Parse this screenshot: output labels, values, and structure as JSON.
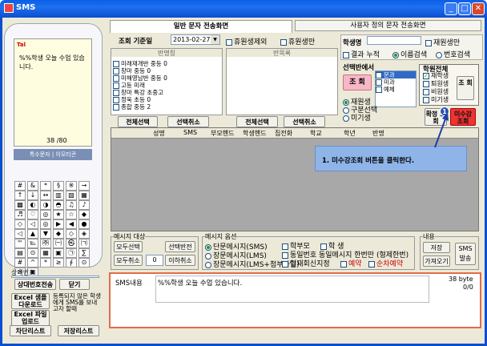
{
  "window": {
    "title": "SMS"
  },
  "phone": {
    "signal_label": "Tal",
    "message": "%%학생 오늘 수업 있습니다.",
    "byte_count": "38 /80",
    "special_chars_button": "특수문자 | 이모티콘",
    "symbols": [
      "#",
      "&",
      "*",
      "§",
      "※",
      "→",
      "↑",
      "↓",
      "↔",
      "▥",
      "▧",
      "▦",
      "▩",
      "◐",
      "◑",
      "◓",
      "♫",
      "♪",
      "♬",
      "♡",
      "◎",
      "★",
      "☆",
      "◆",
      "◇",
      "◁",
      "◎",
      "▶",
      "◀",
      "●",
      "◁",
      "▲",
      "▼",
      "◆",
      "◇",
      "◈",
      "™",
      "℡",
      "㈜",
      "㈠",
      "㉿",
      "㈀",
      "▤",
      "⊙",
      "▦",
      "▣",
      "㉠",
      "∑",
      "#",
      "^",
      "*",
      "≥",
      "∮",
      "⊙",
      "※",
      "▣"
    ],
    "recipient_label": "상대번호",
    "recipient_number": "",
    "name_number_transfer_button": "상대번호전송",
    "close_button": "닫기",
    "excel_sample_button": "Excel 샘플 다운로드",
    "excel_upload_button": "Excel 파일 업로드",
    "unregistered_note": "등록되지 않은 학생에게 SMS를 보내고자 할때",
    "block_list_button": "차단리스트",
    "save_list_button": "저장리스트"
  },
  "tabs": [
    {
      "label": "일반 문자 전송화면",
      "active": true
    },
    {
      "label": "사용자 정의 문자 전송화면",
      "active": false
    }
  ],
  "search": {
    "date_label": "조회 기준일",
    "date_value": "2013-02-27",
    "exclude_leave": "휴원생제외",
    "leave_only": "휴원생만",
    "student_name_label": "학생명",
    "student_name_value": "",
    "enrolled_only": "재원생만",
    "result_accumulate": "결과 누적",
    "name_search": "이름검색",
    "number_search": "번호검색"
  },
  "class_list": {
    "header": "반명칭",
    "items": [
      "미래재개반 중등 0",
      "창마 중등 0",
      "미해영남반 중등 0",
      "고등 미래",
      "창마 특강 초중고",
      "정욱 초등 0",
      "종합 중등 2"
    ],
    "select_all": "전체선택",
    "deselect": "선택취소"
  },
  "selected_class": {
    "header": "반목록",
    "select_all": "전체선택",
    "deselect": "선택취소"
  },
  "filter": {
    "header": "선택반에서",
    "query_button": "조 회",
    "list_items": [
      "문과",
      "미과",
      "예체"
    ],
    "radio_enrolled": "재원생",
    "radio_section": "구분선택",
    "radio_withdrawn": "미기생",
    "academy_header": "학원전체",
    "academy_options": [
      "재학생",
      "퇴원생",
      "비원생",
      "미기생"
    ],
    "academy_query_button": "조 회",
    "confirm_button": "확정 조회",
    "unpaid_button": "미수강 조회",
    "callout_number": "1"
  },
  "table": {
    "columns": [
      "성명",
      "SMS",
      "부모핸드",
      "학생핸드",
      "집전화",
      "학교",
      "학년",
      "반명"
    ],
    "rows": []
  },
  "callout_text": "1. 미수강조회 버튼을 클릭한다.",
  "message_target": {
    "header": "메시지 대상",
    "select_all": "모두선택",
    "select_reverse": "선택반전",
    "deselect_all": "모두취소",
    "count": "0",
    "count_suffix": "이하취소"
  },
  "message_options": {
    "header": "메시지 옵션",
    "short": "단문메시지(SMS)",
    "long": "장문메시지(LMS)",
    "long_attach": "장문메시지(LMS+첨부파일)",
    "parent": "학부모",
    "student": "학    생",
    "same_number_once": "동일번호 동일메시지 한번만 (형제한번)",
    "auto_stop": "현재회신지정",
    "reservation": "예약",
    "order_reserve": "순차예약"
  },
  "content_box": {
    "header": "내용",
    "save_button": "저장",
    "load_button": "가져오기",
    "send_button": "SMS 발송"
  },
  "sms_content": {
    "label": "SMS내용",
    "text": "%%학생 오늘 수업 있습니다.",
    "byte_info": "38 byte",
    "byte_sub": "0/0"
  }
}
